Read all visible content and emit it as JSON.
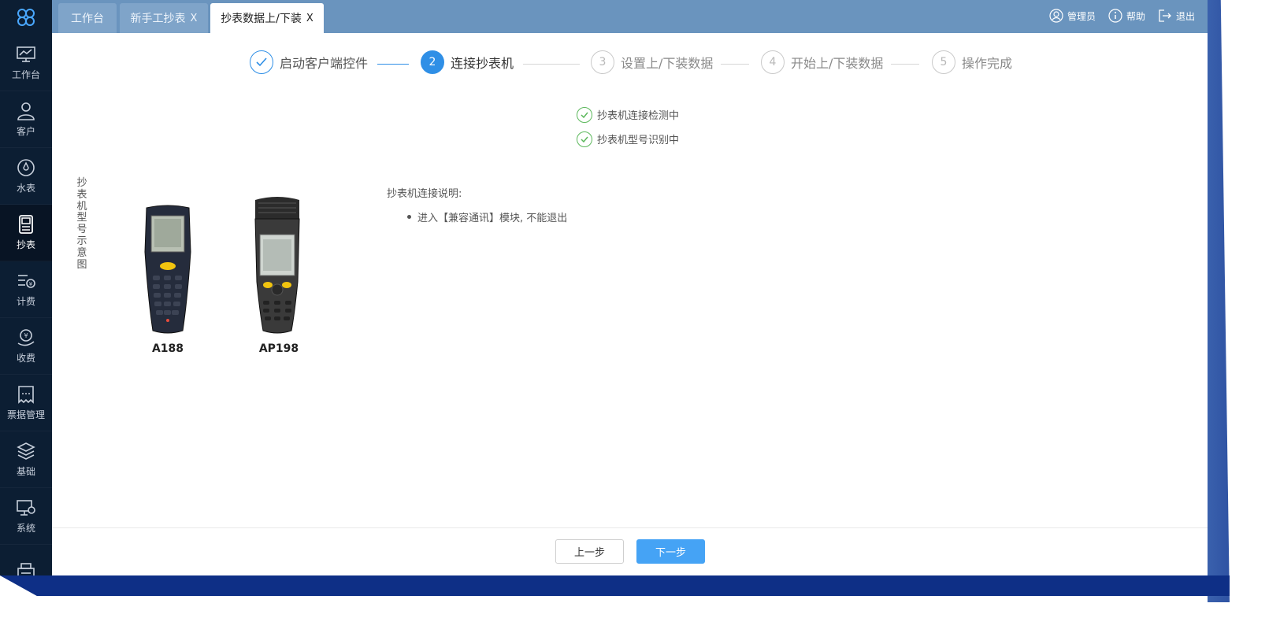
{
  "sidebar": {
    "items": [
      {
        "label": "工作台",
        "icon": "monitor-chart-icon"
      },
      {
        "label": "客户",
        "icon": "user-icon"
      },
      {
        "label": "水表",
        "icon": "meter-dial-icon"
      },
      {
        "label": "抄表",
        "icon": "meter-reader-icon"
      },
      {
        "label": "计费",
        "icon": "billing-icon"
      },
      {
        "label": "收费",
        "icon": "payment-icon"
      },
      {
        "label": "票据管理",
        "icon": "receipt-icon"
      },
      {
        "label": "基础",
        "icon": "layers-icon"
      },
      {
        "label": "系统",
        "icon": "system-settings-icon"
      }
    ]
  },
  "tabs": [
    {
      "label": "工作台",
      "closable": false
    },
    {
      "label": "新手工抄表",
      "closable": true
    },
    {
      "label": "抄表数据上/下装",
      "closable": true,
      "active": true
    }
  ],
  "topbar": {
    "admin": "管理员",
    "help": "帮助",
    "logout": "退出",
    "close_mark": "X"
  },
  "steps": [
    {
      "number": "",
      "label": "启动客户端控件",
      "status": "done"
    },
    {
      "number": "2",
      "label": "连接抄表机",
      "status": "current"
    },
    {
      "number": "3",
      "label": "设置上/下装数据",
      "status": "pending"
    },
    {
      "number": "4",
      "label": "开始上/下装数据",
      "status": "pending"
    },
    {
      "number": "5",
      "label": "操作完成",
      "status": "pending"
    }
  ],
  "checks": [
    "抄表机连接检测中",
    "抄表机型号识别中"
  ],
  "diagram_label": "抄表机型号示意图",
  "devices": [
    {
      "name": "A188"
    },
    {
      "name": "AP198"
    }
  ],
  "instructions": {
    "title": "抄表机连接说明:",
    "items": [
      "进入【兼容通讯】模块, 不能退出"
    ]
  },
  "buttons": {
    "prev": "上一步",
    "next": "下一步"
  },
  "colors": {
    "sidebar": "#0c1e33",
    "topbar": "#6a94be",
    "accent": "#2f8fe6",
    "success": "#5cb85c",
    "next_button": "#45a3f5"
  }
}
